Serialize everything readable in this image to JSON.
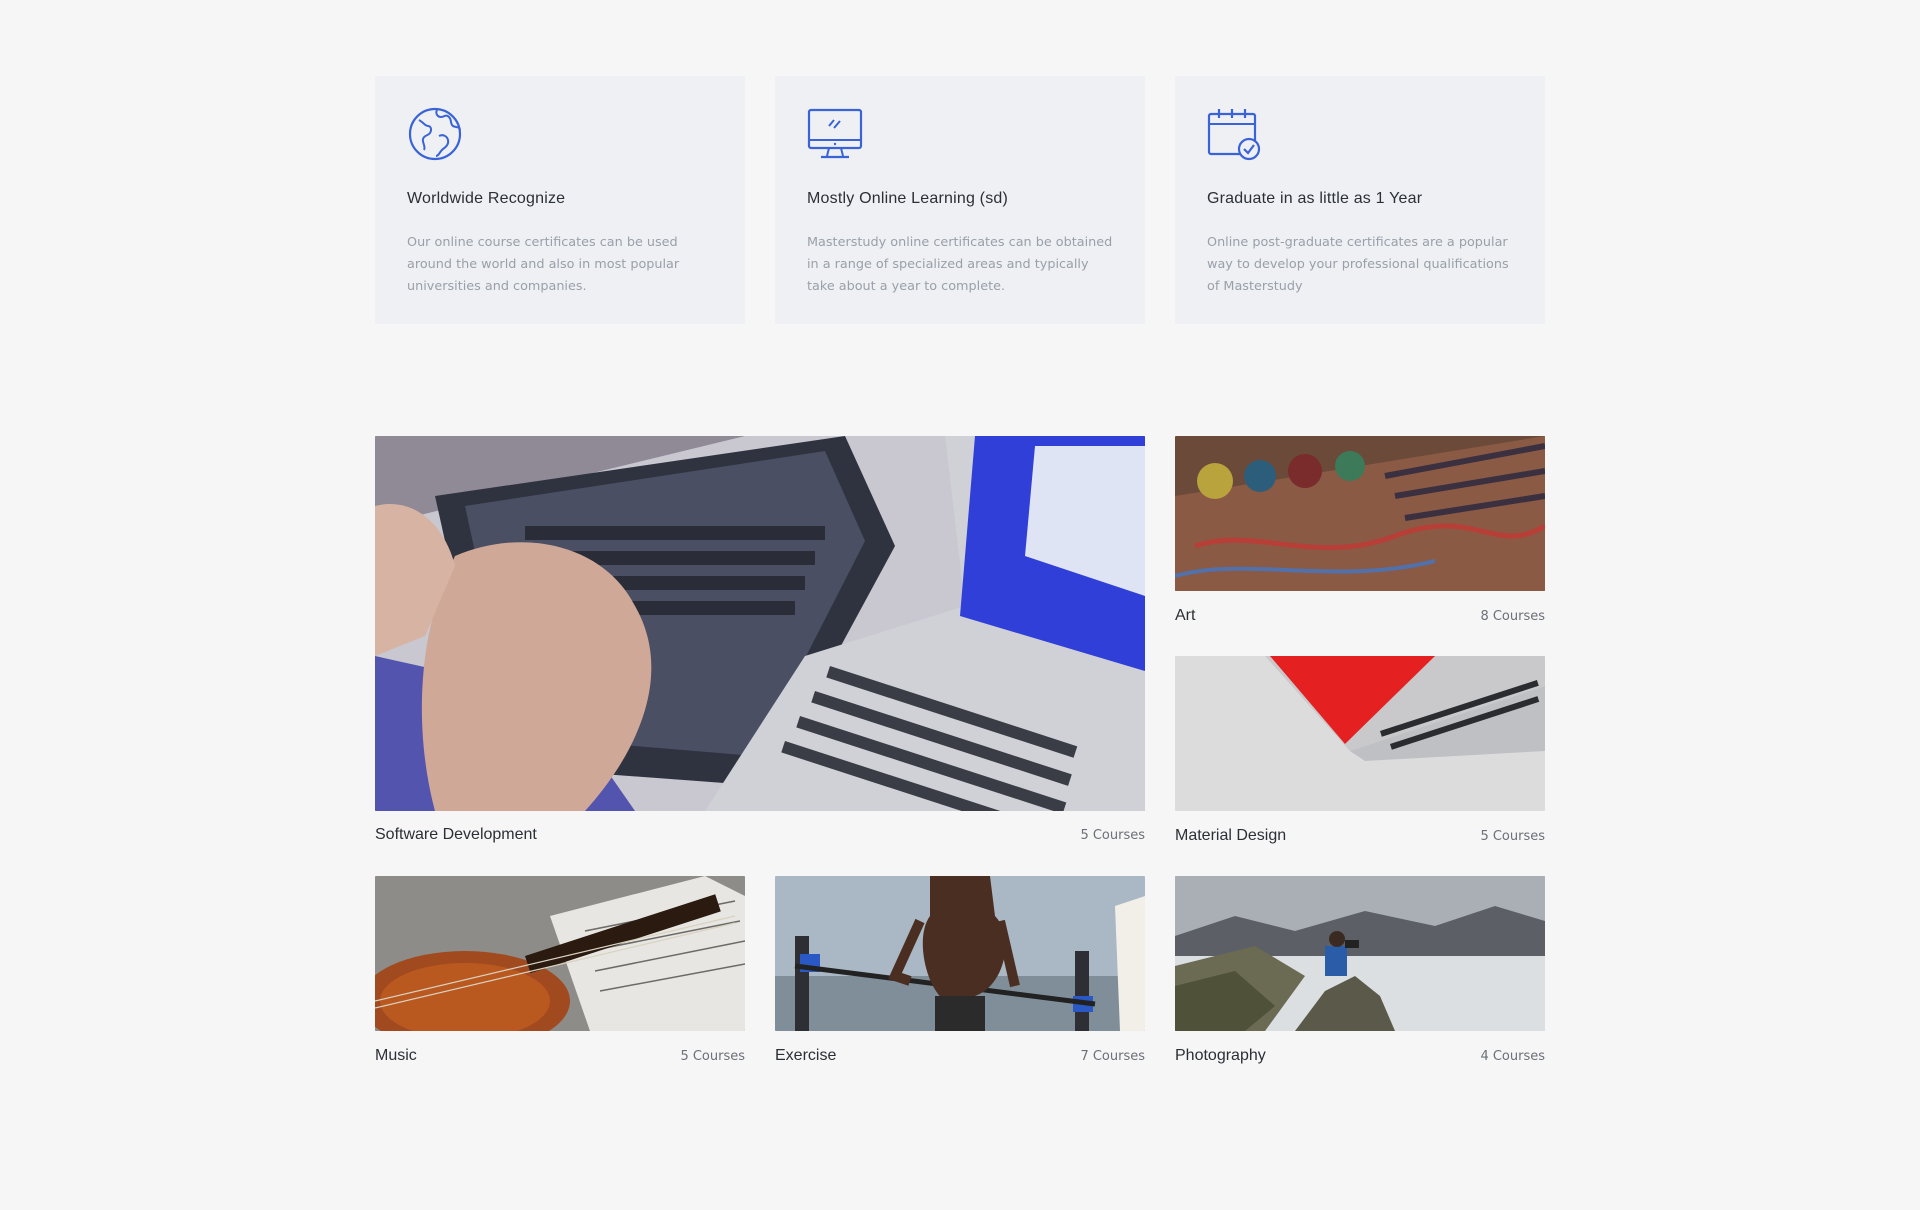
{
  "features": [
    {
      "icon": "globe-icon",
      "title": "Worldwide Recognize",
      "text": "Our online course certificates can be used around the world and also in most popular universities and companies."
    },
    {
      "icon": "monitor-icon",
      "title": "Mostly Online Learning (sd)",
      "text": "Masterstudy online certificates can be obtained in a range of specialized areas and typically take about a year to complete."
    },
    {
      "icon": "calendar-check-icon",
      "title": "Graduate in as little as 1 Year",
      "text": "Online post-graduate certificates are a popular way to develop your professional qualifications of Masterstudy"
    }
  ],
  "categories": [
    {
      "name": "Software Development",
      "count": "5 Courses"
    },
    {
      "name": "Art",
      "count": "8 Courses"
    },
    {
      "name": "Material Design",
      "count": "5 Courses"
    },
    {
      "name": "Music",
      "count": "5 Courses"
    },
    {
      "name": "Exercise",
      "count": "7 Courses"
    },
    {
      "name": "Photography",
      "count": "4 Courses"
    }
  ],
  "colors": {
    "accent": "#3a63d8",
    "background": "#f6f6f6",
    "card": "#eef0f4"
  }
}
